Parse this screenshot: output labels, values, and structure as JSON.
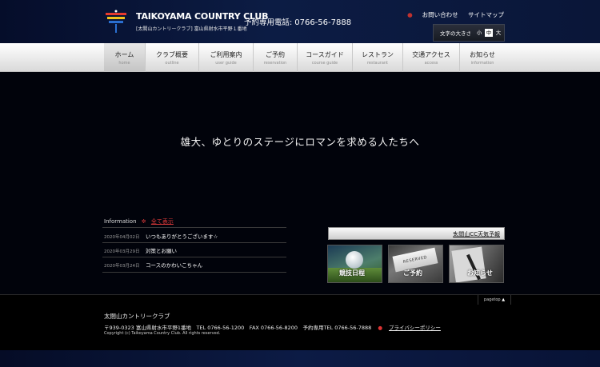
{
  "header": {
    "logo_title": "TAIKOYAMA COUNTRY CLUB",
    "logo_sub": "[太閤山カントリークラブ] 富山県射水市平野１番地",
    "tel_label": "予約専用電話:",
    "tel_number": "0766-56-7888",
    "links": [
      "お問い合わせ",
      "サイトマップ"
    ],
    "fontsize_label": "文字の大きさ",
    "fontsize_options": [
      "小",
      "中",
      "大"
    ]
  },
  "nav": [
    {
      "jp": "ホーム",
      "en": "home"
    },
    {
      "jp": "クラブ概要",
      "en": "outline"
    },
    {
      "jp": "ご利用案内",
      "en": "user guide"
    },
    {
      "jp": "ご予約",
      "en": "reservation"
    },
    {
      "jp": "コースガイド",
      "en": "course guide"
    },
    {
      "jp": "レストラン",
      "en": "restaurant"
    },
    {
      "jp": "交通アクセス",
      "en": "access"
    },
    {
      "jp": "お知らせ",
      "en": "information"
    }
  ],
  "hero": {
    "catch": "雄大、ゆとりのステージにロマンを求める人たちへ"
  },
  "info": {
    "heading": "Information",
    "all_link": "全て表示",
    "items": [
      {
        "date": "2020年04月02日",
        "title": "いつもありがとうございます☆"
      },
      {
        "date": "2020年03月29日",
        "title": "対策とお願い"
      },
      {
        "date": "2020年03月24日",
        "title": "コースのかわいこちゃん"
      }
    ]
  },
  "weather_link": "太閤山CC天気予報",
  "banners": [
    {
      "label": "競技日程"
    },
    {
      "label": "ご予約",
      "card_text": "RESERVED"
    },
    {
      "label": "お知らせ"
    }
  ],
  "footer": {
    "pagetop": "pagetop",
    "name": "太閤山カントリークラブ",
    "address": "〒939-0323 富山県射水市平野1番地　TEL 0766-56-1200　FAX 0766-56-8200　予約専用TEL 0766-56-7888",
    "privacy": "プライバシーポリシー",
    "copyright": "Copyright (c) Taikoyama Country Club. All rights reserved."
  }
}
